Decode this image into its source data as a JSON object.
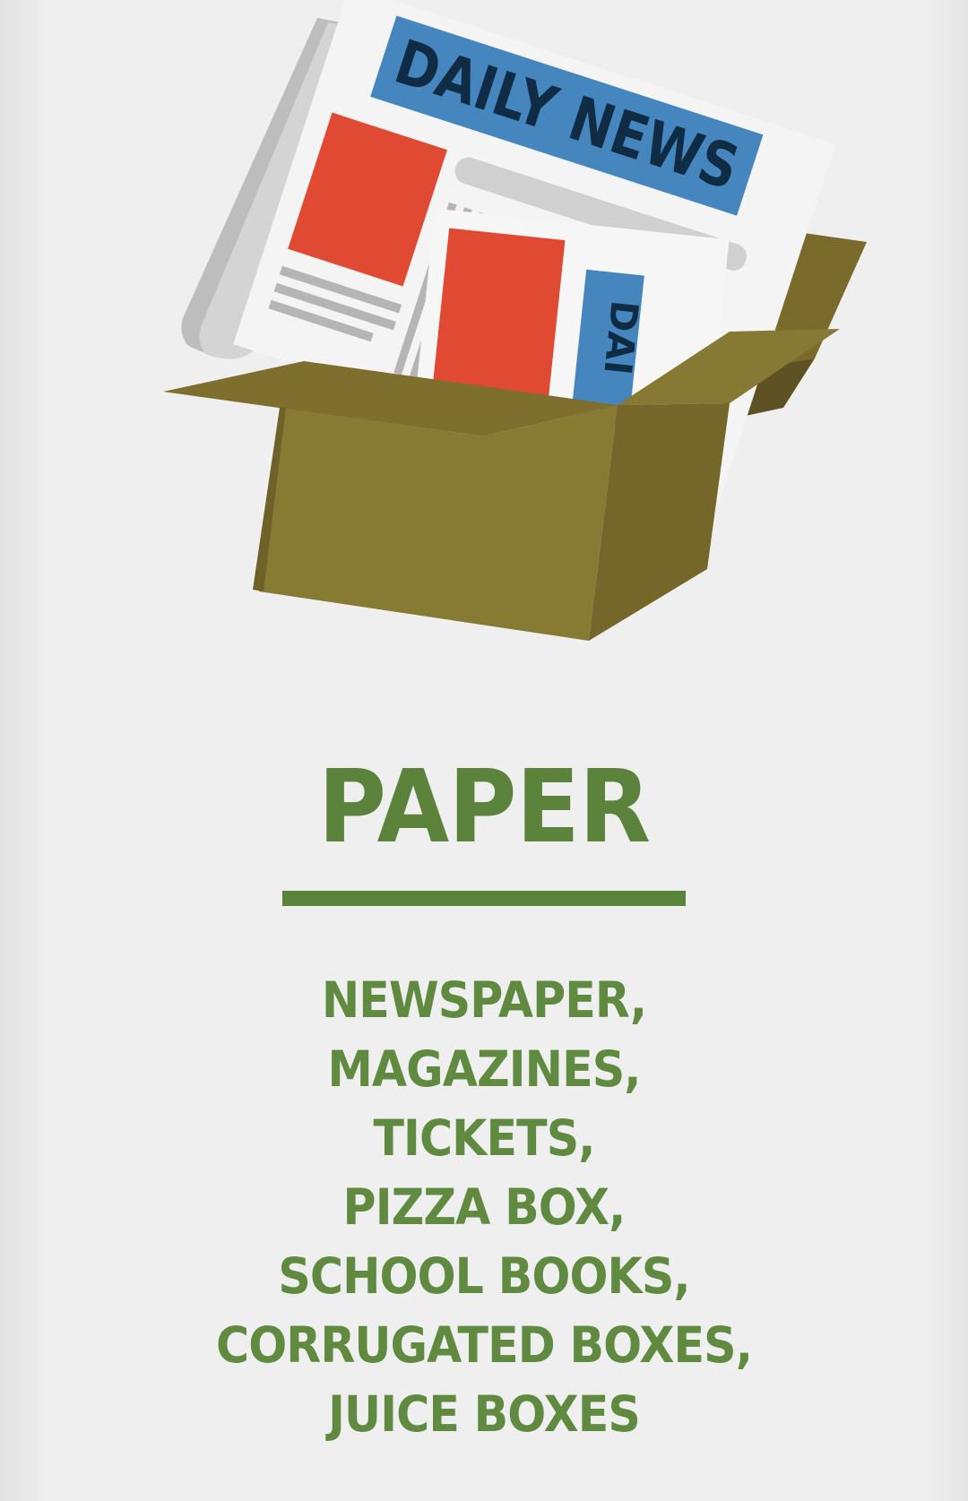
{
  "illustration": {
    "icon": "newspaper-in-box-icon",
    "masthead": "DAILY NEWS",
    "masthead_inner": "DAI"
  },
  "category": {
    "title": "PAPER",
    "accent_color": "#5c833c"
  },
  "items": [
    "NEWSPAPER,",
    "MAGAZINES,",
    "TICKETS,",
    "PIZZA BOX,",
    "SCHOOL BOOKS,",
    "CORRUGATED BOXES,",
    "JUICE BOXES"
  ]
}
